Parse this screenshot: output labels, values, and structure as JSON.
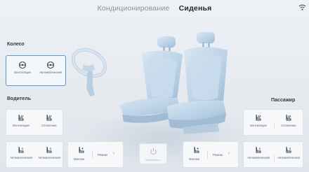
{
  "tabs": [
    {
      "label": "Кондиционирование",
      "active": false
    },
    {
      "label": "Сиденья",
      "active": true
    }
  ],
  "sections": {
    "wheel": "Колесо",
    "driver": "Водитель",
    "passenger": "Пассажир"
  },
  "wheel_controls": [
    {
      "label": "Вентиляция",
      "icon": "steering-heat-icon"
    },
    {
      "label": "Автоматический",
      "icon": "steering-auto-icon"
    }
  ],
  "driver_top": [
    {
      "label": "Вентиляция",
      "icon": "seat-ventilation-icon"
    },
    {
      "label": "Отопление",
      "icon": "seat-heating-icon"
    }
  ],
  "driver_bottom": [
    {
      "label": "Автоматический",
      "icon": "seat-auto-icon"
    },
    {
      "label": "Автоматический",
      "icon": "seat-auto-heat-icon"
    }
  ],
  "driver_massage": {
    "label": "Массаж",
    "mode": "Режим"
  },
  "power": {
    "label": "Выключено"
  },
  "passenger_top": [
    {
      "label": "Вентиляция",
      "icon": "seat-ventilation-icon"
    },
    {
      "label": "Отопление",
      "icon": "seat-heating-icon"
    }
  ],
  "passenger_massage": {
    "label": "Массаж",
    "mode": "Режим"
  },
  "passenger_bottom": [
    {
      "label": "Автоматический",
      "icon": "seat-auto-icon"
    },
    {
      "label": "Автоматический",
      "icon": "seat-auto-heat-icon"
    }
  ],
  "colors": {
    "accent": "#5b93d6",
    "seat": "#b9d1e6"
  }
}
